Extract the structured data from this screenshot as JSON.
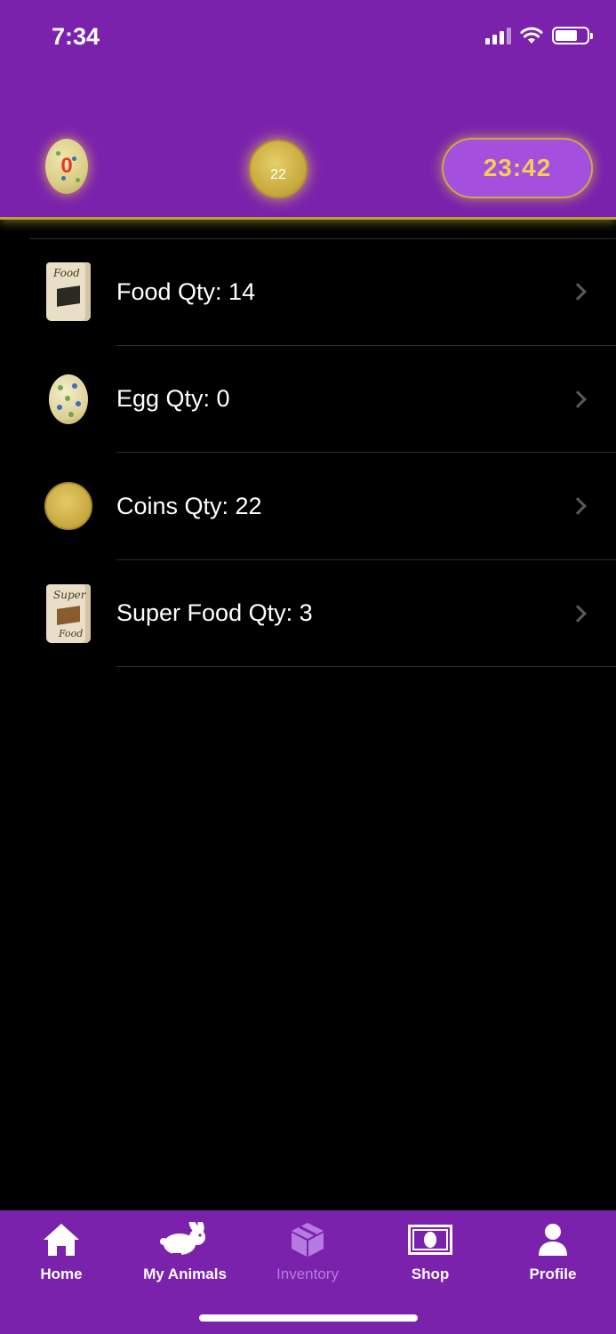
{
  "status_bar": {
    "time": "7:34"
  },
  "header": {
    "egg_count": "0",
    "coin_count": "22",
    "timer": "23:42"
  },
  "inventory": {
    "items": [
      {
        "label": "Food Qty: 14",
        "icon": "food-bag-icon",
        "bag_text": "Food"
      },
      {
        "label": "Egg Qty: 0",
        "icon": "egg-icon"
      },
      {
        "label": "Coins Qty: 22",
        "icon": "coin-icon"
      },
      {
        "label": "Super Food Qty: 3",
        "icon": "super-food-bag-icon",
        "bag_text": "Super",
        "bag_text2": "Food"
      }
    ]
  },
  "tabbar": {
    "tabs": [
      {
        "label": "Home",
        "icon": "home-icon"
      },
      {
        "label": "My Animals",
        "icon": "rabbit-icon"
      },
      {
        "label": "Inventory",
        "icon": "box-icon",
        "active": true
      },
      {
        "label": "Shop",
        "icon": "money-icon"
      },
      {
        "label": "Profile",
        "icon": "person-icon"
      }
    ]
  },
  "colors": {
    "header_bg": "#7b22ad",
    "timer_bg": "#a44fde",
    "timer_text": "#f2cf52",
    "active_tab": "#b57be0",
    "egg_count_text": "#e53a25"
  }
}
